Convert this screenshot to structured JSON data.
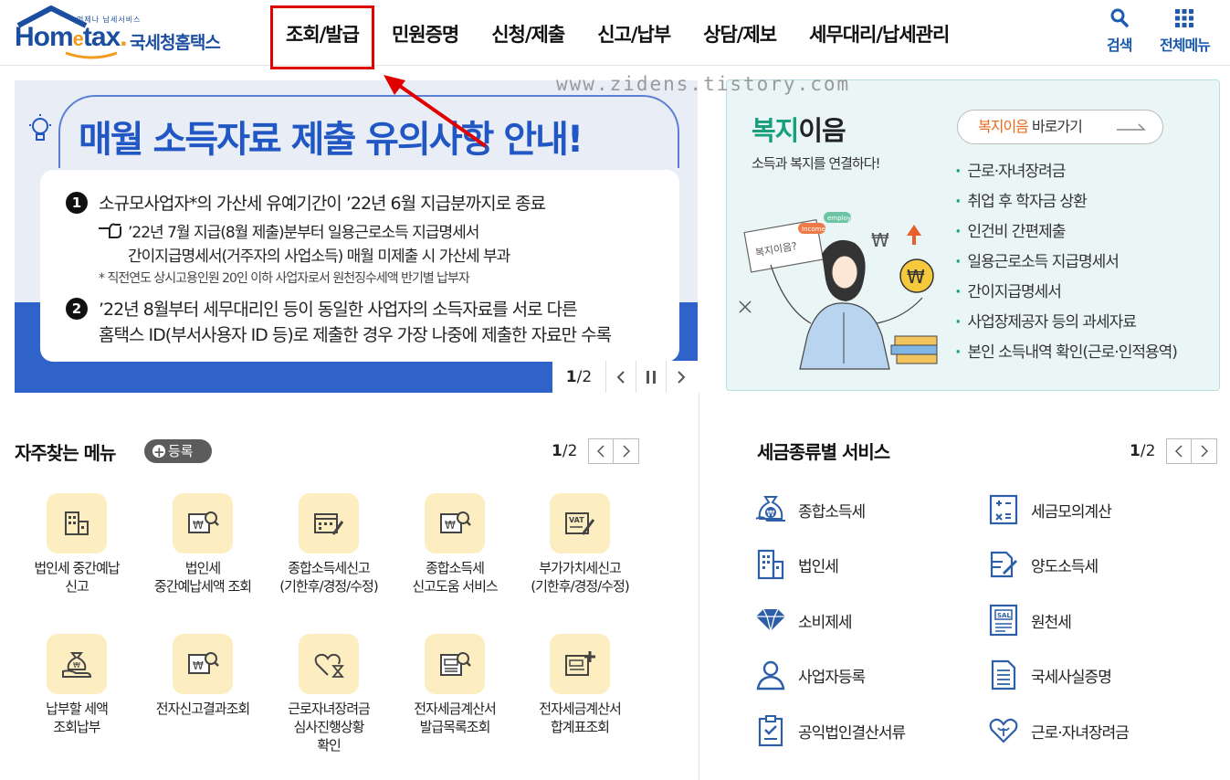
{
  "header": {
    "logo_small_text": "언제나 납세서비스",
    "logo_word_h": "Hom",
    "logo_word_e": "e",
    "logo_word_tail": "tax",
    "logo_kr": "국세청홈택스",
    "nav": [
      "조회/발급",
      "민원증명",
      "신청/제출",
      "신고/납부",
      "상담/제보",
      "세무대리/납세관리"
    ],
    "search_label": "검색",
    "all_menu_label": "전체메뉴"
  },
  "watermark": "www.zidens.tistory.com",
  "banner": {
    "title": "매월 소득자료 제출 유의사항 안내!",
    "item1_num": "1",
    "item1_line1": "소규모사업자*의 가산세 유예기간이 ’22년 6월 지급분까지로 종료",
    "item1_line2": "’22년 7월 지급(8월 제출)분부터 일용근로소득 지급명세서",
    "item1_line3": "간이지급명세서(거주자의 사업소득) 매월 미제출 시 가산세 부과",
    "item1_note": "* 직전연도 상시고용인원 20인 이하 사업자로서 원천징수세액 반기별 납부자",
    "item2_num": "2",
    "item2_line1": "’22년 8월부터 세무대리인 등이 동일한 사업자의 소득자료를 서로 다른",
    "item2_line2": "홈택스 ID(부서사용자 ID 등)로 제출한 경우 가장 나중에 제출한 자료만 수록",
    "pager_current": "1",
    "pager_total": "/2"
  },
  "welfare": {
    "title_green": "복지",
    "title_rest": "이음",
    "subtitle": "소득과 복지를 연결하다!",
    "btn_orange": "복지이음",
    "btn_rest": " 바로가기",
    "illus_sign": "복지이음?",
    "illus_tag1": "Income",
    "illus_tag2": "employ",
    "items": [
      "근로·자녀장려금",
      "취업 후 학자금 상환",
      "인건비 간편제출",
      "일용근로소득 지급명세서",
      "간이지급명세서",
      "사업장제공자 등의 과세자료",
      "본인 소득내역 확인(근로·인적용역)"
    ]
  },
  "favorites": {
    "title": "자주찾는 메뉴",
    "register_label": "등록",
    "pager_current": "1",
    "pager_total": "/2",
    "items": [
      {
        "label": "법인세 중간예납\n신고",
        "icon": "building-icon"
      },
      {
        "label": "법인세\n중간예납세액 조회",
        "icon": "won-search-icon"
      },
      {
        "label": "종합소득세신고\n(기한후/경정/수정)",
        "icon": "calendar-pen-icon"
      },
      {
        "label": "종합소득세\n신고도움 서비스",
        "icon": "won-search-icon"
      },
      {
        "label": "부가가치세신고\n(기한후/경정/수정)",
        "icon": "vat-pen-icon"
      },
      {
        "label": "납부할 세액\n조회납부",
        "icon": "money-bag-hand-icon"
      },
      {
        "label": "전자신고결과조회",
        "icon": "won-search-icon"
      },
      {
        "label": "근로자녀장려금\n심사진행상황\n확인",
        "icon": "heart-hourglass-icon"
      },
      {
        "label": "전자세금계산서\n발급목록조회",
        "icon": "invoice-search-icon"
      },
      {
        "label": "전자세금계산서\n합계표조회",
        "icon": "invoice-plus-icon"
      }
    ]
  },
  "tax_services": {
    "title": "세금종류별 서비스",
    "pager_current": "1",
    "pager_total": "/2",
    "items": [
      {
        "label": "종합소득세",
        "icon": "money-bag-icon"
      },
      {
        "label": "세금모의계산",
        "icon": "calculator-icon"
      },
      {
        "label": "법인세",
        "icon": "building-icon"
      },
      {
        "label": "양도소득세",
        "icon": "document-pen-icon"
      },
      {
        "label": "소비제세",
        "icon": "diamond-icon"
      },
      {
        "label": "원천세",
        "icon": "receipt-icon"
      },
      {
        "label": "사업자등록",
        "icon": "person-icon"
      },
      {
        "label": "국세사실증명",
        "icon": "document-icon"
      },
      {
        "label": "공익법인결산서류",
        "icon": "clipboard-check-icon"
      },
      {
        "label": "근로·자녀장려금",
        "icon": "heart-hands-icon"
      }
    ]
  },
  "colors": {
    "brand_blue": "#1c4e9f",
    "accent_orange": "#f29b1d",
    "highlight_red": "#e10000",
    "welfare_green": "#17a07b",
    "tile_yellow": "#fdeec2"
  }
}
